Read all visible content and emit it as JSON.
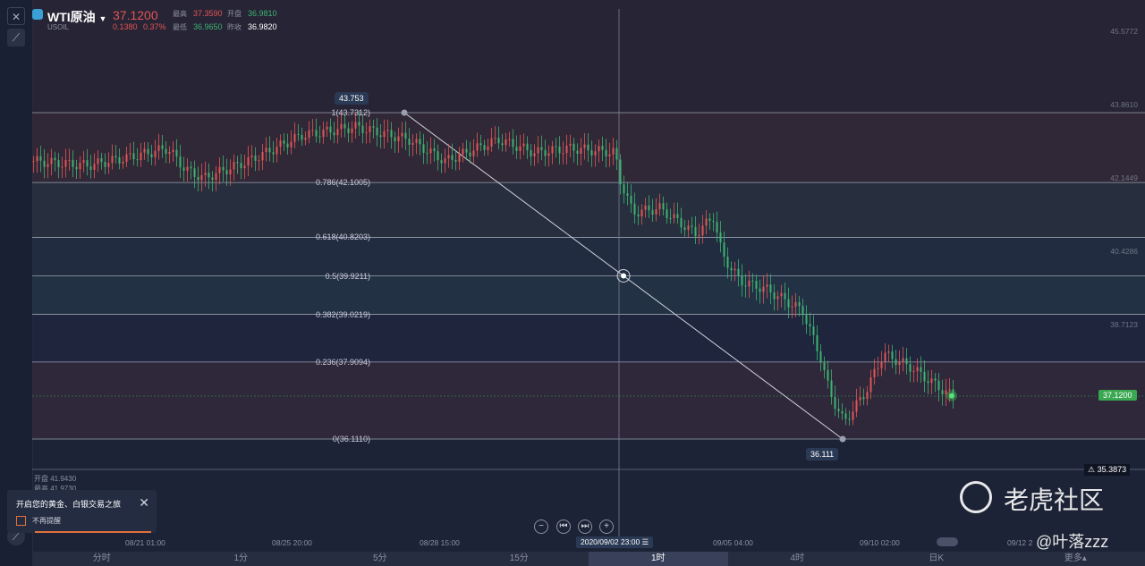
{
  "header": {
    "symbol_name": "WTI原油",
    "symbol_code": "USOIL",
    "last_price": "37.1200",
    "change": "0.1380",
    "change_pct": "0.37%",
    "high_label": "最高",
    "high_value": "37.3590",
    "open_label": "开盘",
    "open_value": "36.9810",
    "low_label": "最低",
    "low_value": "36.9650",
    "prev_close_label": "昨收",
    "prev_close_value": "36.9820"
  },
  "fib_levels": [
    {
      "label": "1(43.7312)",
      "value": 43.7312
    },
    {
      "label": "0.786(42.1005)",
      "value": 42.1005
    },
    {
      "label": "0.618(40.8203)",
      "value": 40.8203
    },
    {
      "label": "0.5(39.9211)",
      "value": 39.9211
    },
    {
      "label": "0.382(39.0219)",
      "value": 39.0219
    },
    {
      "label": "0.236(37.9094)",
      "value": 37.9094
    },
    {
      "label": "0(36.1110)",
      "value": 36.111
    }
  ],
  "bubbles": {
    "high": "43.753",
    "low": "36.111"
  },
  "price_axis": [
    "45.5772",
    "43.8610",
    "42.1449",
    "40.4286",
    "38.7123"
  ],
  "current_price_tag": "37.1200",
  "min_price_tag": "35.3873",
  "time_axis": [
    "08/21 01:00",
    "08/25 20:00",
    "08/28 15:00",
    "09/05 04:00",
    "09/10 02:00",
    "09/12 2"
  ],
  "crosshair_time": "2020/09/02 23:00",
  "ohlc_mini": {
    "open_label": "开盘",
    "open_value": "41.9430",
    "high_label": "最高",
    "high_value": "41.9730"
  },
  "notice": {
    "text": "开启您的黄金、白银交易之旅",
    "checkbox_label": "不再提醒"
  },
  "timebar": [
    {
      "label": "分时",
      "active": false
    },
    {
      "label": "1分",
      "active": false
    },
    {
      "label": "5分",
      "active": false
    },
    {
      "label": "15分",
      "active": false
    },
    {
      "label": "1时",
      "active": true
    },
    {
      "label": "4时",
      "active": false
    },
    {
      "label": "日K",
      "active": false
    },
    {
      "label": "更多▴",
      "active": false
    }
  ],
  "watermark": {
    "brand": "老虎社区",
    "handle": "@叶落zzz"
  },
  "colors": {
    "up": "#e25555",
    "down": "#3cb371",
    "background": "#1c2336",
    "accent": "#3aa0d6"
  }
}
